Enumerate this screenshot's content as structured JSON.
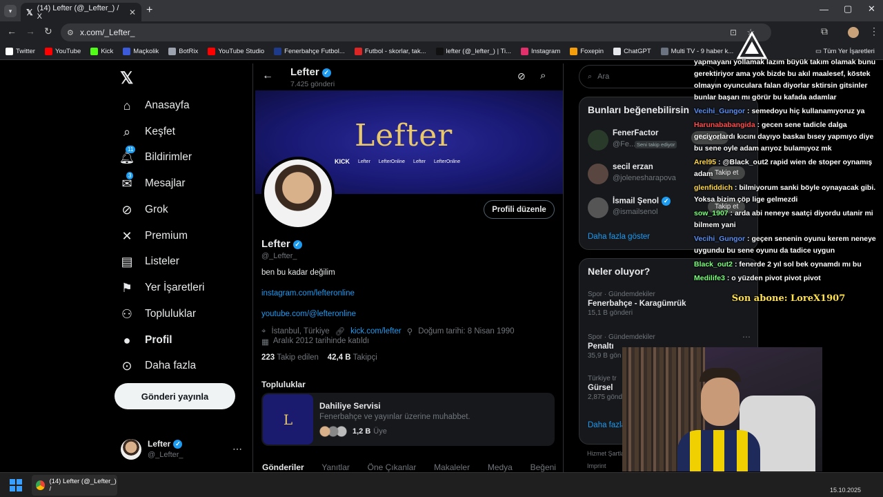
{
  "browser": {
    "tab_title": "(14) Lefter (@_Lefter_) / X",
    "url": "x.com/_Lefter_",
    "all_bookmarks": "Tüm Yer İşaretleri"
  },
  "bookmarks": [
    {
      "label": "Twitter",
      "color": "#ffffff"
    },
    {
      "label": "YouTube",
      "color": "#ff0000"
    },
    {
      "label": "Kick",
      "color": "#53fc18"
    },
    {
      "label": "Maçkolik",
      "color": "#3b5bdb"
    },
    {
      "label": "BotRix",
      "color": "#9ca3af"
    },
    {
      "label": "YouTube Studio",
      "color": "#ff0000"
    },
    {
      "label": "Fenerbahçe Futbol...",
      "color": "#1e3a8a"
    },
    {
      "label": "Futbol - skorlar, tak...",
      "color": "#dc2626"
    },
    {
      "label": "lefter (@_lefter_) | Ti...",
      "color": "#111111"
    },
    {
      "label": "Instagram",
      "color": "#e1306c"
    },
    {
      "label": "Foxepin",
      "color": "#f59e0b"
    },
    {
      "label": "ChatGPT",
      "color": "#e5e7eb"
    },
    {
      "label": "Multi TV - 9 haber k...",
      "color": "#6b7280"
    }
  ],
  "nav": {
    "items": [
      "Anasayfa",
      "Keşfet",
      "Bildirimler",
      "Mesajlar",
      "Grok",
      "Premium",
      "Listeler",
      "Yer İşaretleri",
      "Topluluklar",
      "Profil",
      "Daha fazla"
    ],
    "notif_badge": "11",
    "msg_badge": "3",
    "post_button": "Gönderi yayınla",
    "account_name": "Lefter",
    "account_handle": "@_Lefter_"
  },
  "profile": {
    "header_name": "Lefter",
    "post_count": "7.425 gönderi",
    "banner_text": "Lefter",
    "banner_kick": "KICK",
    "banner_handles": [
      "Lefter",
      "LefterOnline",
      "Lefter",
      "LefterOnline"
    ],
    "edit_button": "Profili düzenle",
    "name": "Lefter",
    "handle": "@_Lefter_",
    "bio": "ben bu kadar değilim",
    "link1": "instagram.com/lefteronline",
    "link2": "youtube.com/@lefteronline",
    "location": "İstanbul, Türkiye",
    "website": "kick.com/lefter",
    "birthday": "Doğum tarihi: 8 Nisan 1990",
    "joined": "Aralık 2012 tarihinde katıldı",
    "following_count": "223",
    "following_label": "Takip edilen",
    "followers_count": "42,4 B",
    "followers_label": "Takipçi",
    "communities_title": "Topluluklar",
    "community_name": "Dahiliye Servisi",
    "community_desc": "Fenerbahçe ve yayınlar üzerine muhabbet.",
    "community_members": "1,2 B",
    "community_members_label": "Üye",
    "tabs": [
      "Gönderiler",
      "Yanıtlar",
      "Öne Çıkanlar",
      "Makaleler",
      "Medya",
      "Beğeni"
    ]
  },
  "right": {
    "search_placeholder": "Ara",
    "suggest_title": "Bunları beğenebilirsin",
    "suggestions": [
      {
        "name": "FenerFactor",
        "handle": "@Fe...",
        "badge": "Seni takip ediyor"
      },
      {
        "name": "secil erzan",
        "handle": "@jolenesharapova"
      },
      {
        "name": "İsmail Şenol",
        "handle": "@ismailsenol"
      }
    ],
    "follow_label": "Takip et",
    "show_more": "Daha fazla göster",
    "trends_title": "Neler oluyor?",
    "trends": [
      {
        "meta": "Spor · Gündemdekiler",
        "title": "Fenerbahçe - Karagümrük",
        "count": "15,1 B gönderi"
      },
      {
        "meta": "Spor · Gündemdekiler",
        "title": "Penaltı",
        "count": "35,9 B gön"
      },
      {
        "meta": "Türkiye tr",
        "title": "Gürsel",
        "count": "2,875 gönd"
      }
    ],
    "trends_more": "Daha fazla",
    "footer1": "Hizmet Şartla",
    "footer2": "Imprint"
  },
  "chat": {
    "top_text": "yapmayanı yollamak lazım büyük takım olamak bunu gerektiriyor ama yok bizde bu akıl maalesef, köstek olmayın oyunculara falan diyorlar sktirsin gitsinler bunlar başarı mı görür bu kafada adamlar",
    "messages": [
      {
        "user": "Vecihi_Gungor",
        "color": "#5b8def",
        "text": ": semedoyu hiç kullanamıyoruz ya"
      },
      {
        "user": "Harunababangida",
        "color": "#ff4d4d",
        "text": ": gecen sene tadicle dalga geciyorlardı kıcını dayıyo baskaı bısey yapmıyo diye bu sene oyle adam arıyoz bulamıyoz mk"
      },
      {
        "user": "Arel95",
        "color": "#ffd84d",
        "text": ": @Black_out2 rapid wien de stoper oynamış adam"
      },
      {
        "user": "glenfiddich",
        "color": "#ffd84d",
        "text": ": bilmiyorum sanki böyle oynayacak gibi. Yoksa bizim çöp lige gelmezdi"
      },
      {
        "user": "sow_1907",
        "color": "#7dff7d",
        "text": ": arda abi neneye saatçi diyordu utanir mi bilmem yani"
      },
      {
        "user": "Vecihi_Gungor",
        "color": "#5b8def",
        "text": ": geçen senenin oyunu kerem neneye uygundu bu sene oyunu da tadice uygun"
      },
      {
        "user": "Black_out2",
        "color": "#7dff7d",
        "text": ": fenerde 2 yıl sol bek oynamdı mı bu"
      },
      {
        "user": "Medilife3",
        "color": "#7dff7d",
        "text": ": o yüzden pivot pivot pivot"
      }
    ],
    "last_sub": "Son abone: LoreX1907"
  },
  "taskbar": {
    "window_title": "(14) Lefter (@_Lefter_) /",
    "date": "15.10.2025"
  }
}
